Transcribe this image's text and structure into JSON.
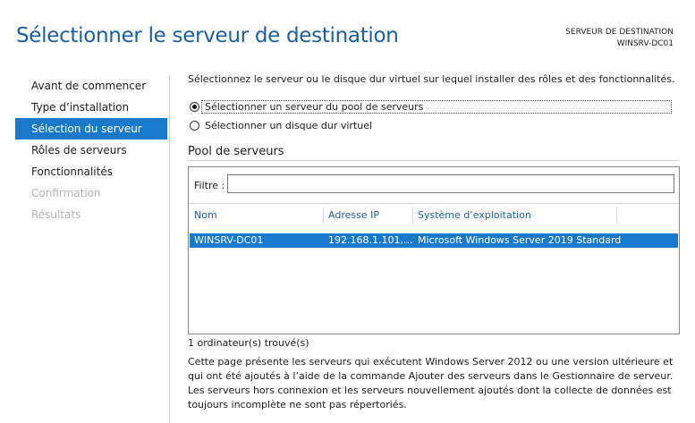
{
  "header": {
    "title": "Sélectionner le serveur de destination",
    "destination_label": "SERVEUR DE DESTINATION",
    "destination_server": "WINSRV-DC01"
  },
  "sidebar": {
    "items": [
      {
        "label": "Avant de commencer",
        "state": "normal"
      },
      {
        "label": "Type d’installation",
        "state": "normal"
      },
      {
        "label": "Sélection du serveur",
        "state": "selected"
      },
      {
        "label": "Rôles de serveurs",
        "state": "normal"
      },
      {
        "label": "Fonctionnalités",
        "state": "normal"
      },
      {
        "label": "Confirmation",
        "state": "disabled"
      },
      {
        "label": "Résultats",
        "state": "disabled"
      }
    ]
  },
  "main": {
    "intro": "Sélectionnez le serveur ou le disque dur virtuel sur lequel installer des rôles et des fonctionnalités.",
    "options": [
      {
        "label": "Sélectionner un serveur du pool de serveurs",
        "checked": true
      },
      {
        "label": "Sélectionner un disque dur virtuel",
        "checked": false
      }
    ],
    "pool": {
      "title": "Pool de serveurs",
      "filter_label": "Filtre :",
      "filter_value": "",
      "columns": [
        "Nom",
        "Adresse IP",
        "Système d’exploitation"
      ],
      "rows": [
        {
          "name": "WINSRV-DC01",
          "ip": "192.168.1.101,...",
          "os": "Microsoft Windows Server 2019 Standard",
          "selected": true
        }
      ]
    },
    "found_count": "1 ordinateur(s) trouvé(s)",
    "description": "Cette page présente les serveurs qui exécutent Windows Server 2012 ou une version ultérieure et qui ont été ajoutés à l’aide de la commande Ajouter des serveurs dans le Gestionnaire de serveur. Les serveurs hors connexion et les serveurs nouvellement ajoutés dont la collecte de données est toujours incomplète ne sont pas répertoriés."
  },
  "colors": {
    "accent": "#1979ca",
    "title": "#1a5fa0",
    "disabled": "#b4b4b4"
  }
}
